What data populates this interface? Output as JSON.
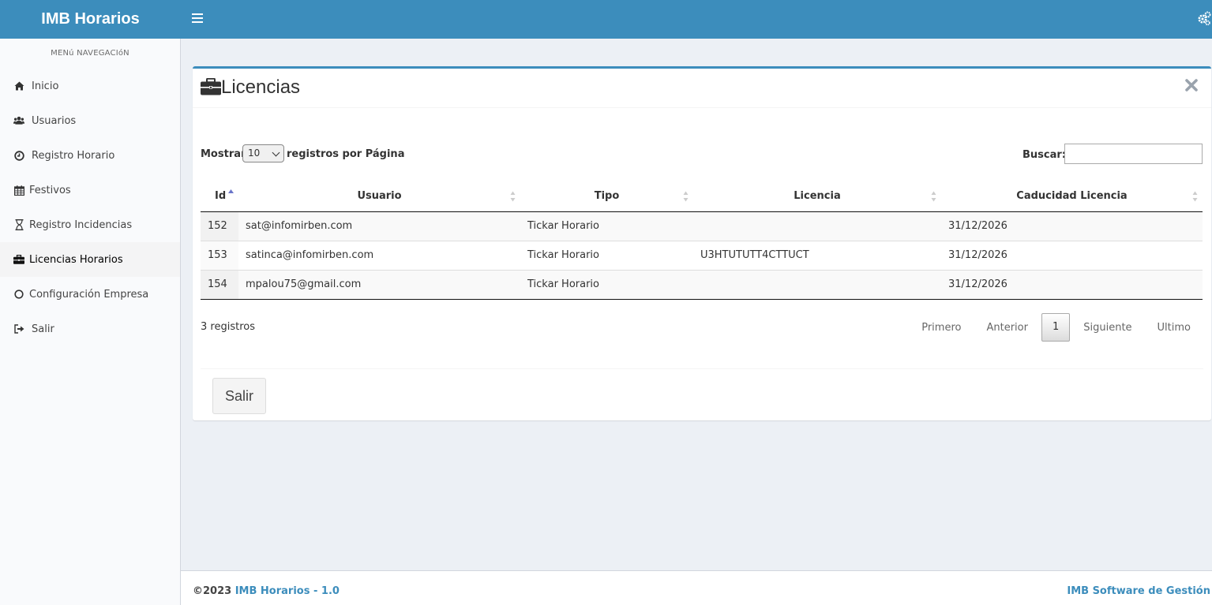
{
  "header": {
    "brand": "IMB Horarios"
  },
  "sidebar": {
    "section_title": "MENú NAVEGACIóN",
    "items": [
      {
        "label": "Inicio",
        "icon": "home-icon"
      },
      {
        "label": "Usuarios",
        "icon": "users-icon"
      },
      {
        "label": "Registro Horario",
        "icon": "clock-icon"
      },
      {
        "label": "Festivos",
        "icon": "calendar-icon"
      },
      {
        "label": "Registro Incidencias",
        "icon": "hourglass-icon"
      },
      {
        "label": "Licencias Horarios",
        "icon": "briefcase-icon",
        "active": true
      },
      {
        "label": "Configuración Empresa",
        "icon": "circle-icon"
      },
      {
        "label": "Salir",
        "icon": "sign-out-icon"
      }
    ]
  },
  "box": {
    "title": "Licencias"
  },
  "table_controls": {
    "show_label": "Mostrar",
    "page_length": "10",
    "show_suffix": "registros por Página",
    "search_label": "Buscar:",
    "search_value": ""
  },
  "table": {
    "columns": [
      "Id",
      "Usuario",
      "Tipo",
      "Licencia",
      "Caducidad Licencia"
    ],
    "rows": [
      [
        "152",
        "sat@infomirben.com",
        "Tickar Horario",
        "",
        "31/12/2026"
      ],
      [
        "153",
        "satinca@infomirben.com",
        "Tickar Horario",
        "U3HTUTUTT4CTTUCT",
        "31/12/2026"
      ],
      [
        "154",
        "mpalou75@gmail.com",
        "Tickar Horario",
        "",
        "31/12/2026"
      ]
    ]
  },
  "pagination": {
    "info": "3 registros",
    "first": "Primero",
    "previous": "Anterior",
    "current": "1",
    "next": "Siguiente",
    "last": "Ultimo"
  },
  "actions": {
    "exit_label": "Salir"
  },
  "footer": {
    "copyright": "©2023",
    "app_link": "IMB Horarios - 1.0",
    "company": "IMB Software de Gestión"
  },
  "colors": {
    "header": "#3c8dbc",
    "accent": "#3c8dbc"
  }
}
